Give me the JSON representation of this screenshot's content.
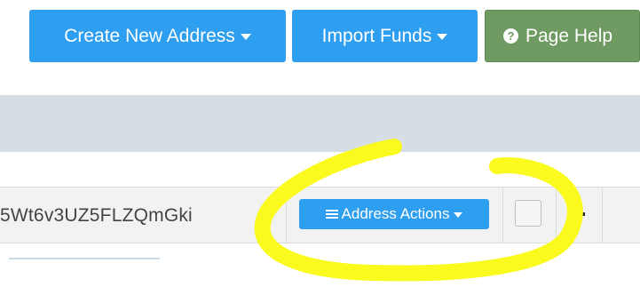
{
  "toolbar": {
    "create_address_label": "Create New Address",
    "import_funds_label": "Import Funds",
    "page_help_label": "Page Help",
    "help_icon_glyph": "?"
  },
  "address_row": {
    "address_text": "5Wt6v3UZ5FLZQmGki",
    "actions_label": "Address Actions"
  },
  "annotation": {
    "color": "#fafa1e"
  }
}
